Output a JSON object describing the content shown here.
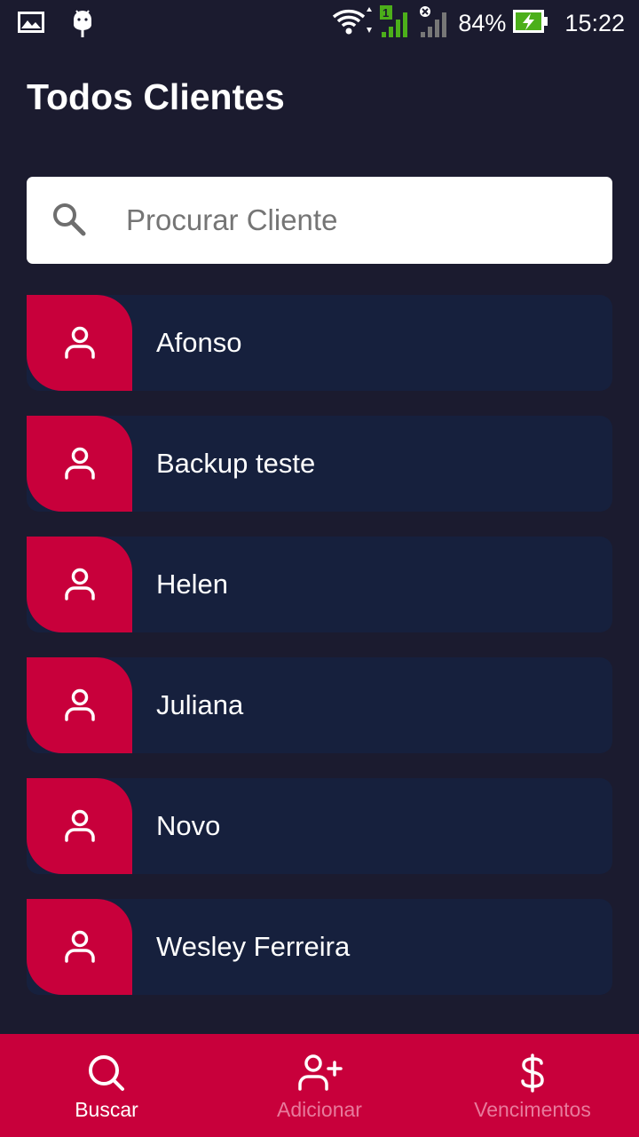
{
  "status_bar": {
    "battery_percent": "84%",
    "time": "15:22",
    "signal_label": "1"
  },
  "header": {
    "title": "Todos Clientes"
  },
  "search": {
    "placeholder": "Procurar Cliente",
    "value": ""
  },
  "clients": [
    {
      "name": "Afonso"
    },
    {
      "name": "Backup teste"
    },
    {
      "name": "Helen"
    },
    {
      "name": "Juliana"
    },
    {
      "name": "Novo"
    },
    {
      "name": "Wesley Ferreira"
    }
  ],
  "bottom_nav": {
    "items": [
      {
        "label": "Buscar",
        "icon": "search-icon",
        "active": true
      },
      {
        "label": "Adicionar",
        "icon": "user-plus-icon",
        "active": false
      },
      {
        "label": "Vencimentos",
        "icon": "dollar-icon",
        "active": false
      }
    ]
  },
  "colors": {
    "background": "#1b1b2f",
    "card": "#16203d",
    "accent": "#c8003b",
    "inactive_nav": "#e87a9c"
  }
}
